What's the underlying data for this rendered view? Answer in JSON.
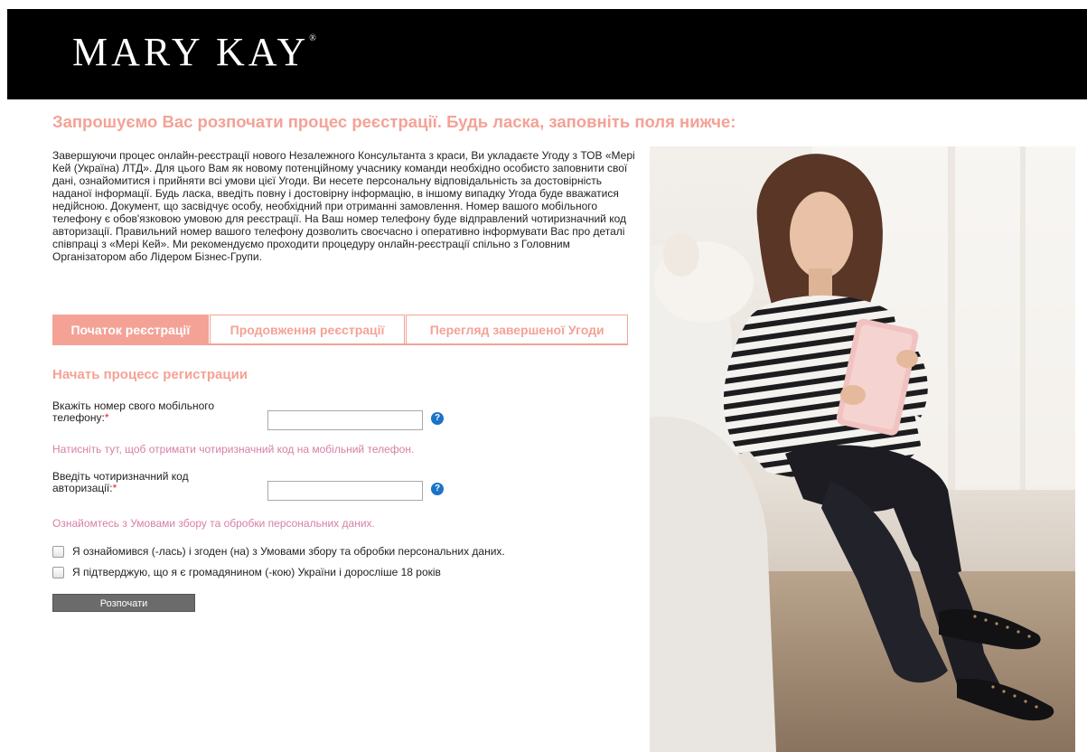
{
  "header": {
    "logo_text": "MARY KAY",
    "logo_mark": "®",
    "background_color": "#000000"
  },
  "page_title": "Запрошуємо Вас розпочати процес реєстрації. Будь ласка, заповніть поля нижче:",
  "intro_text": "Завершуючи процес онлайн-реєстрації нового Незалежного Консультанта з краси, Ви укладаєте Угоду з ТОВ «Мері Кей (Україна) ЛТД». Для цього Вам як новому потенційному учаснику команди необхідно особисто заповнити свої дані, ознайомитися і прийняти всі умови цієї Угоди. Ви несете персональну відповідальність за достовірність наданої інформації. Будь ласка, введіть повну і достовірну інформацію, в іншому випадку Угода буде вважатися недійсною. Документ, що засвідчує особу, необхідний при отриманні замовлення. Номер вашого мобільного телефону є обов'язковою умовою для реєстрації. На Ваш номер телефону буде відправлений чотиризначний код авторизації. Правильний номер вашого телефону дозволить своєчасно і оперативно інформувати Вас про деталі співпраці з «Мері Кей». Ми рекомендуємо проходити процедуру онлайн-реєстрації спільно з Головним Організатором або Лідером Бізнес-Групи.",
  "tabs": [
    {
      "label": "Початок реєстрації",
      "active": true
    },
    {
      "label": "Продовження реєстрації",
      "active": false
    },
    {
      "label": "Перегляд завершеної Угоди",
      "active": false
    }
  ],
  "form": {
    "section_title": "Начать процесс регистрации",
    "phone_label": "Вкажіть номер свого мобільного телефону:",
    "phone_value": "",
    "get_code_link": "Натисніть тут, щоб отримати чотиризначний код на мобільний телефон.",
    "code_label": "Введіть чотиризначний код авторизації:",
    "code_value": "",
    "required_mark": "*",
    "help_icon": "question-circle-icon",
    "terms_link": "Ознайомтесь з Умовами збору та обробки персональних даних.",
    "checkbox_terms_label": "Я ознайомився (-лась) і згоден (на) з Умовами збору та обробки персональних даних.",
    "checkbox_terms_checked": false,
    "checkbox_age_label": "Я підтверджую, що я є громадянином (-кою) України і доросліше 18 років",
    "checkbox_age_checked": false,
    "submit_label": "Розпочати"
  },
  "colors": {
    "accent": "#f4a296",
    "link": "#d77fa5",
    "help_icon": "#1a73c7",
    "button": "#6b6b6b"
  }
}
